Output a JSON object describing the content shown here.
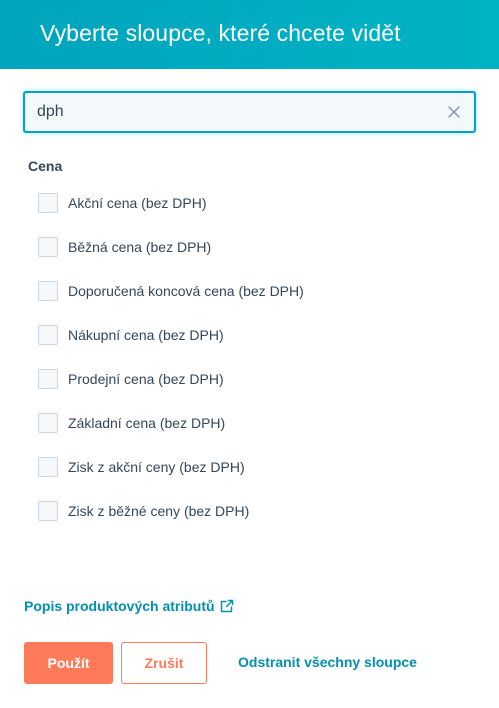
{
  "modal": {
    "title": "Vyberte sloupce, které chcete vidět"
  },
  "search": {
    "value": "dph",
    "placeholder": ""
  },
  "group": {
    "title": "Cena",
    "options": [
      {
        "label": "Akční cena (bez DPH)",
        "checked": false
      },
      {
        "label": "Běžná cena (bez DPH)",
        "checked": false
      },
      {
        "label": "Doporučená koncová cena (bez DPH)",
        "checked": false
      },
      {
        "label": "Nákupní cena (bez DPH)",
        "checked": false
      },
      {
        "label": "Prodejní cena (bez DPH)",
        "checked": false
      },
      {
        "label": "Základní cena (bez DPH)",
        "checked": false
      },
      {
        "label": "Zisk z akční ceny (bez DPH)",
        "checked": false
      },
      {
        "label": "Zisk z běžné ceny (bez DPH)",
        "checked": false
      }
    ]
  },
  "footer": {
    "link_label": "Popis produktových atributů",
    "apply_label": "Použít",
    "cancel_label": "Zrušit",
    "remove_all_label": "Odstranit všechny sloupce"
  },
  "colors": {
    "header": "#00a4bd",
    "accent": "#ff7a59",
    "link": "#0091ae",
    "text": "#33475b"
  },
  "icons": {
    "clear": "close-icon",
    "external": "external-link-icon"
  }
}
